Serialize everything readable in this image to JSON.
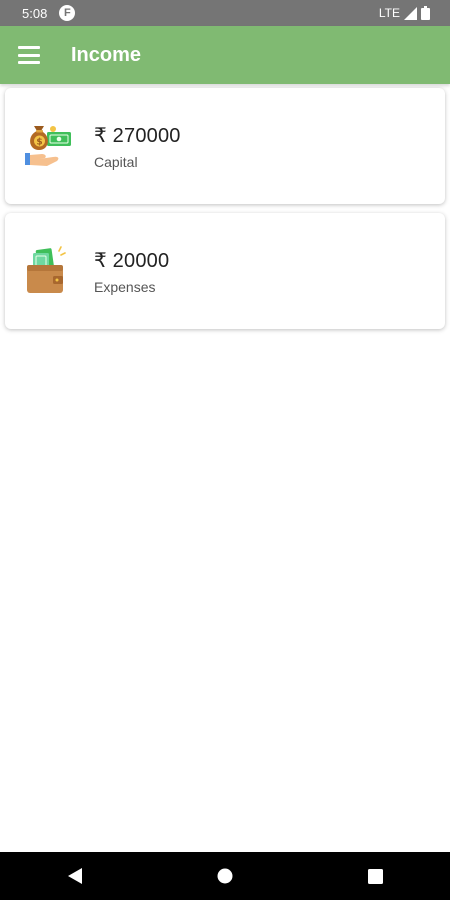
{
  "status_bar": {
    "time": "5:08",
    "notification_badge": "F",
    "network": "LTE"
  },
  "app_bar": {
    "title": "Income",
    "menu_icon": "hamburger-menu-icon"
  },
  "cards": [
    {
      "amount": "₹ 270000",
      "label": "Capital",
      "icon": "money-bag-hand-icon"
    },
    {
      "amount": "₹ 20000",
      "label": "Expenses",
      "icon": "wallet-cash-icon"
    }
  ],
  "nav_bar": {
    "back_icon": "back-triangle-icon",
    "home_icon": "home-circle-icon",
    "recents_icon": "recents-square-icon"
  },
  "colors": {
    "status_bar": "#757575",
    "app_bar": "#80ba72",
    "nav_bar": "#000000"
  }
}
